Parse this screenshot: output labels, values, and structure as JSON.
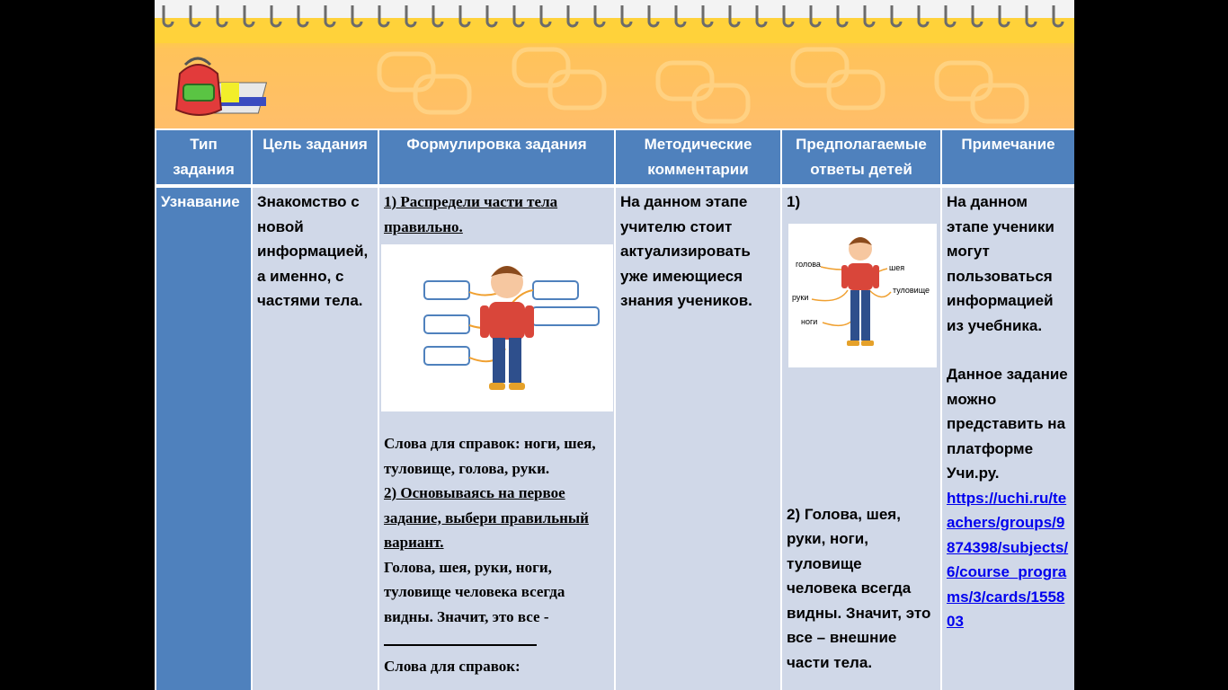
{
  "header": {
    "logo_icon": "school-backpack-books-icon",
    "spiral_icon": "notebook-spiral-rings"
  },
  "table": {
    "columns": [
      "Тип задания",
      "Цель задания",
      "Формулировка задания",
      "Методические комментарии",
      "Предполагаемые ответы детей",
      "Примечание"
    ],
    "row": {
      "type": "Узнавание",
      "goal": "Знакомство с новой информацией, а именно, с частями тела.",
      "task1_title": "1) Распредели части тела правильно.",
      "task1_words": "Слова для справок: ноги, шея, туловище, голова, руки.",
      "task2_title": "2) Основываясь на первое задание, выбери правильный вариант.",
      "task2_text": "Голова, шея, руки, ноги, туловище человека всегда видны. Значит, это все -",
      "task2_words": "Слова для справок:",
      "comment": "На данном этапе учителю стоит актуализировать уже имеющиеся знания учеников.",
      "answer1": "1)",
      "answer_labels": [
        "голова",
        "шея",
        "руки",
        "туловище",
        "ноги"
      ],
      "answer2": "2) Голова, шея, руки, ноги, туловище человека всегда видны. Значит, это все – внешние части тела.",
      "note1": "На данном этапе ученики могут пользоваться информацией из учебника.",
      "note2": "Данное задание можно представить на платформе Учи.ру.",
      "link": "https://uchi.ru/teachers/groups/9874398/subjects/6/course_programs/3/cards/155803"
    }
  },
  "colors": {
    "header_blue": "#4f81bd",
    "cell_bg": "#d0d8e8",
    "banner": "#ffc35a",
    "link": "#0000ee"
  }
}
